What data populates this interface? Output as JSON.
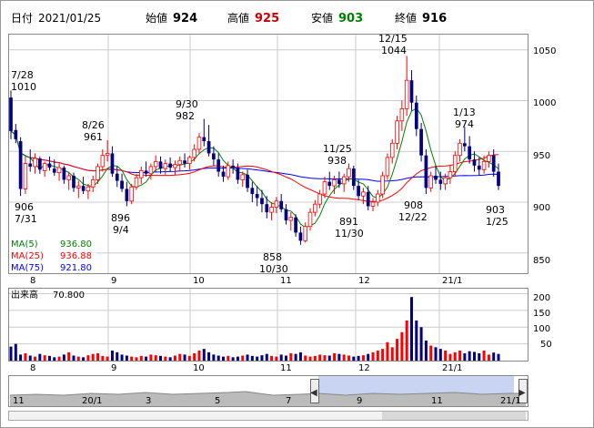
{
  "header": {
    "date_label": "日付",
    "date": "2021/01/25",
    "open_label": "始値",
    "open": "924",
    "high_label": "高値",
    "high": "925",
    "low_label": "安値",
    "low": "903",
    "close_label": "終値",
    "close": "916"
  },
  "colors": {
    "up": "#ff0000",
    "down": "#000080",
    "ma5": "#008000",
    "ma25": "#ff0000",
    "ma75": "#0000ff",
    "volume": "#000080",
    "high_value": "#cc0000",
    "low_value": "#008000",
    "grid": "#cccccc",
    "navigator_fill": "#c8d4f2"
  },
  "main_chart": {
    "y_ticks": [
      "1050",
      "1000",
      "950",
      "900",
      "850"
    ],
    "x_ticks": [
      "9",
      "10",
      "11",
      "12",
      "21/1"
    ],
    "x_start_label": "8",
    "legend": [
      {
        "label": "MA(5)",
        "value": "936.80"
      },
      {
        "label": "MA(25)",
        "value": "936.88"
      },
      {
        "label": "MA(75)",
        "value": "921.80"
      }
    ],
    "annotations": [
      {
        "price": "1010",
        "date": "7/28"
      },
      {
        "price": "906",
        "date": "7/31"
      },
      {
        "price": "961",
        "date": "8/26"
      },
      {
        "price": "896",
        "date": "9/4"
      },
      {
        "price": "982",
        "date": "9/30"
      },
      {
        "price": "858",
        "date": "10/30"
      },
      {
        "price": "938",
        "date": "11/25"
      },
      {
        "price": "891",
        "date": "11/30"
      },
      {
        "price": "1044",
        "date": "12/15"
      },
      {
        "price": "908",
        "date": "12/22"
      },
      {
        "price": "974",
        "date": "1/13"
      },
      {
        "price": "903",
        "date": "1/25"
      }
    ]
  },
  "volume_chart": {
    "label": "出来高",
    "value": "70.800",
    "y_ticks": [
      "200",
      "150",
      "100",
      "50"
    ],
    "x_ticks": [
      "8",
      "9",
      "10",
      "11",
      "12",
      "21/1"
    ]
  },
  "navigator": {
    "x_ticks": [
      "11",
      "20/1",
      "3",
      "5",
      "7",
      "9",
      "11",
      "21/1"
    ],
    "left_arrow": "◀",
    "right_arrow": "▶"
  },
  "chart_data": {
    "type": "candlestick",
    "ylim": [
      830,
      1065
    ],
    "period": "2020/07/27 - 2021/01/25",
    "ma_legend": {
      "MA(5)": 936.8,
      "MA(25)": 936.88,
      "MA(75)": 921.8
    },
    "annotated_points": [
      {
        "date": "7/28",
        "value": 1010
      },
      {
        "date": "7/31",
        "value": 906
      },
      {
        "date": "8/26",
        "value": 961
      },
      {
        "date": "9/4",
        "value": 896
      },
      {
        "date": "9/30",
        "value": 982
      },
      {
        "date": "10/30",
        "value": 858
      },
      {
        "date": "11/25",
        "value": 938
      },
      {
        "date": "11/30",
        "value": 891
      },
      {
        "date": "12/15",
        "value": 1044
      },
      {
        "date": "12/22",
        "value": 908
      },
      {
        "date": "1/13",
        "value": 974
      },
      {
        "date": "1/25",
        "value": 903
      }
    ],
    "candles": [
      [
        1003,
        1010,
        962,
        970
      ],
      [
        971,
        977,
        958,
        962
      ],
      [
        960,
        964,
        906,
        913
      ],
      [
        913,
        945,
        908,
        938
      ],
      [
        938,
        952,
        930,
        935
      ],
      [
        935,
        948,
        928,
        943
      ],
      [
        943,
        945,
        928,
        932
      ],
      [
        931,
        940,
        925,
        938
      ],
      [
        938,
        945,
        931,
        934
      ],
      [
        933,
        942,
        926,
        929
      ],
      [
        929,
        938,
        921,
        934
      ],
      [
        934,
        936,
        918,
        922
      ],
      [
        922,
        930,
        912,
        926
      ],
      [
        926,
        929,
        910,
        914
      ],
      [
        914,
        921,
        904,
        916
      ],
      [
        916,
        925,
        908,
        911
      ],
      [
        911,
        918,
        903,
        915
      ],
      [
        915,
        926,
        910,
        922
      ],
      [
        922,
        938,
        918,
        935
      ],
      [
        935,
        952,
        930,
        946
      ],
      [
        946,
        961,
        940,
        948
      ],
      [
        948,
        955,
        925,
        928
      ],
      [
        928,
        935,
        915,
        921
      ],
      [
        921,
        928,
        910,
        913
      ],
      [
        913,
        920,
        896,
        901
      ],
      [
        901,
        918,
        898,
        915
      ],
      [
        915,
        928,
        912,
        924
      ],
      [
        924,
        935,
        918,
        931
      ],
      [
        931,
        940,
        925,
        928
      ],
      [
        928,
        938,
        922,
        935
      ],
      [
        935,
        946,
        930,
        940
      ],
      [
        940,
        945,
        928,
        933
      ],
      [
        933,
        942,
        927,
        938
      ],
      [
        938,
        944,
        930,
        934
      ],
      [
        934,
        941,
        927,
        937
      ],
      [
        937,
        945,
        930,
        941
      ],
      [
        941,
        948,
        934,
        938
      ],
      [
        938,
        946,
        932,
        944
      ],
      [
        944,
        957,
        940,
        952
      ],
      [
        952,
        968,
        948,
        964
      ],
      [
        964,
        982,
        955,
        960
      ],
      [
        960,
        976,
        945,
        948
      ],
      [
        948,
        955,
        936,
        942
      ],
      [
        942,
        948,
        925,
        930
      ],
      [
        930,
        936,
        920,
        925
      ],
      [
        925,
        940,
        922,
        936
      ],
      [
        936,
        942,
        928,
        934
      ],
      [
        934,
        938,
        918,
        922
      ],
      [
        922,
        930,
        915,
        927
      ],
      [
        927,
        932,
        910,
        914
      ],
      [
        914,
        920,
        900,
        908
      ],
      [
        908,
        916,
        896,
        904
      ],
      [
        904,
        912,
        890,
        898
      ],
      [
        898,
        906,
        884,
        890
      ],
      [
        890,
        900,
        882,
        895
      ],
      [
        895,
        905,
        889,
        901
      ],
      [
        901,
        908,
        890,
        893
      ],
      [
        893,
        898,
        878,
        882
      ],
      [
        882,
        890,
        872,
        885
      ],
      [
        885,
        888,
        866,
        870
      ],
      [
        870,
        876,
        858,
        862
      ],
      [
        862,
        880,
        860,
        876
      ],
      [
        876,
        894,
        872,
        890
      ],
      [
        890,
        902,
        886,
        898
      ],
      [
        898,
        912,
        894,
        908
      ],
      [
        908,
        925,
        904,
        920
      ],
      [
        920,
        930,
        912,
        916
      ],
      [
        916,
        926,
        908,
        922
      ],
      [
        922,
        930,
        914,
        918
      ],
      [
        918,
        928,
        910,
        925
      ],
      [
        925,
        938,
        920,
        933
      ],
      [
        933,
        936,
        912,
        916
      ],
      [
        916,
        922,
        902,
        906
      ],
      [
        906,
        914,
        898,
        910
      ],
      [
        910,
        916,
        892,
        896
      ],
      [
        896,
        904,
        891,
        900
      ],
      [
        900,
        912,
        896,
        908
      ],
      [
        908,
        930,
        904,
        926
      ],
      [
        926,
        948,
        922,
        944
      ],
      [
        944,
        962,
        938,
        958
      ],
      [
        958,
        985,
        952,
        980
      ],
      [
        980,
        1000,
        970,
        992
      ],
      [
        992,
        1044,
        985,
        1020
      ],
      [
        1020,
        1030,
        990,
        998
      ],
      [
        998,
        1005,
        965,
        972
      ],
      [
        972,
        978,
        940,
        946
      ],
      [
        946,
        952,
        908,
        914
      ],
      [
        914,
        930,
        910,
        926
      ],
      [
        926,
        936,
        918,
        922
      ],
      [
        922,
        930,
        912,
        918
      ],
      [
        918,
        928,
        912,
        924
      ],
      [
        924,
        936,
        918,
        930
      ],
      [
        930,
        950,
        925,
        946
      ],
      [
        946,
        962,
        940,
        958
      ],
      [
        958,
        974,
        950,
        955
      ],
      [
        955,
        965,
        938,
        942
      ],
      [
        942,
        950,
        930,
        936
      ],
      [
        936,
        944,
        926,
        932
      ],
      [
        932,
        946,
        928,
        940
      ],
      [
        940,
        950,
        934,
        946
      ],
      [
        946,
        952,
        925,
        930
      ],
      [
        930,
        938,
        912,
        916
      ]
    ],
    "volume": [
      42,
      50,
      18,
      22,
      15,
      12,
      20,
      16,
      14,
      10,
      12,
      18,
      25,
      15,
      12,
      10,
      16,
      20,
      22,
      14,
      12,
      30,
      25,
      18,
      15,
      12,
      10,
      14,
      12,
      18,
      16,
      14,
      12,
      10,
      15,
      20,
      18,
      14,
      22,
      30,
      35,
      25,
      18,
      15,
      12,
      14,
      10,
      12,
      15,
      18,
      14,
      12,
      16,
      20,
      14,
      12,
      18,
      15,
      22,
      20,
      25,
      15,
      12,
      14,
      18,
      16,
      15,
      22,
      20,
      18,
      15,
      12,
      14,
      16,
      20,
      25,
      30,
      35,
      55,
      40,
      65,
      85,
      120,
      190,
      120,
      100,
      60,
      45,
      40,
      35,
      30,
      20,
      25,
      30,
      22,
      28,
      26,
      22,
      30,
      18,
      24,
      20
    ]
  }
}
